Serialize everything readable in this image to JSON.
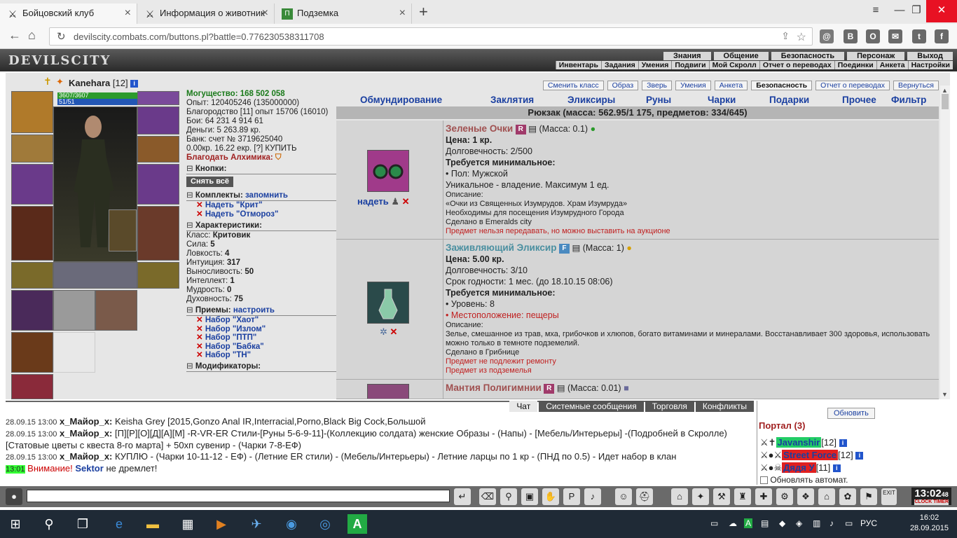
{
  "browser": {
    "tabs": [
      {
        "title": "Бойцовский клуб",
        "icon": "swords-icon"
      },
      {
        "title": "Информация о животник",
        "icon": "swords-icon"
      },
      {
        "title": "Подземка",
        "icon": "dungeon-icon"
      }
    ],
    "url": "devilscity.combats.com/buttons.pl?battle=0.776230538311708"
  },
  "game": {
    "logo": "DEVILSCITY",
    "topnav": [
      "Знания",
      "Общение",
      "Безопасность",
      "Персонаж",
      "Выход"
    ],
    "subnav": [
      "Инвентарь",
      "Задания",
      "Умения",
      "Подвиги",
      "Мой Скролл",
      "Отчет о переводах",
      "Поединки",
      "Анкета",
      "Настройки"
    ]
  },
  "character": {
    "name": "Kanehara",
    "level": "[12]",
    "hp": "3607/3607",
    "mana": "51/51",
    "power_label": "Могущество: 168 502 058",
    "lines": [
      "Опыт: 120405246 (135000000)",
      "Благородство [11] опыт 15706 (16010)",
      "Бои:  64 231  4 914  61",
      "Деньги: 5 263.89 кр.",
      "Банк: счет № 3719625040",
      "0.00кр. 16.22 екр. [?] КУПИТЬ"
    ],
    "alchemist": "Благодать Алхимика:",
    "buttons_section": "Кнопки:",
    "undress_btn": "Снять всё",
    "sets_section": "Комплекты:",
    "sets_remember": "запомнить",
    "sets": [
      "Надеть \"Крит\"",
      "Надеть \"Отмороз\""
    ],
    "char_section": "Характеристики:",
    "attributes": [
      {
        "k": "Класс:",
        "v": "Критовик"
      },
      {
        "k": "Сила:",
        "v": "5"
      },
      {
        "k": "Ловкость:",
        "v": "4"
      },
      {
        "k": "Интуиция:",
        "v": "317"
      },
      {
        "k": "Выносливость:",
        "v": "50"
      },
      {
        "k": "Интеллект:",
        "v": "1"
      },
      {
        "k": "Мудрость:",
        "v": "0"
      },
      {
        "k": "Духовность:",
        "v": "75"
      }
    ],
    "tricks_section": "Приемы:",
    "tricks_config": "настроить",
    "tricks": [
      "Набор \"Хаот\"",
      "Набор \"Излом\"",
      "Набор \"ПТП\"",
      "Набор \"Бабка\"",
      "Набор \"ТН\""
    ],
    "mods_section": "Модификаторы:"
  },
  "panel": {
    "top_buttons": [
      "Сменить класс",
      "Образ",
      "Зверь",
      "Умения",
      "Анкета",
      "Безопасность",
      "Отчет о переводах",
      "Вернуться"
    ],
    "categories": [
      "Обмундирование",
      "Заклятия",
      "Эликсиры",
      "Руны",
      "Чарки",
      "Подарки",
      "Прочее",
      "Фильтр"
    ],
    "bag_title": "Рюкзак (масса: 562.95/1 175, предметов: 334/645)",
    "items": [
      {
        "name": "Зеленые Очки",
        "tag": "R",
        "mass": "(Масса: 0.1)",
        "price": "Цена: 1 кр.",
        "durability": "Долговечность: 2/500",
        "req": "Требуется минимальное:",
        "lines": [
          "• Пол: Мужской",
          "Уникальное - владение. Максимум 1 ед."
        ],
        "desc_label": "Описание:",
        "desc": [
          "«Очки из Священных Изумрудов. Храм Изумруда»",
          "Необходимы для посещения Изумрудного Города",
          "Сделано в Emeralds city"
        ],
        "note": "Предмет нельзя передавать, но можно выставить на аукционе",
        "action": "надеть"
      },
      {
        "name": "Заживляющий Эликсир",
        "tag": "F",
        "mass": "(Масса: 1)",
        "price": "Цена: 5.00 кр.",
        "durability": "Долговечность: 3/10",
        "expiry": "Срок годности: 1 мес. (до 18.10.15 08:06)",
        "req": "Требуется минимальное:",
        "level": "• Уровень: 8",
        "location": "• Местоположение: пещеры",
        "desc_label": "Описание:",
        "desc": "Зелье, смешанное из трав, мха, грибочков и хлюпов, богато витаминами и минералами. Восстанавливает 300 здоровья, использовать можно только в темноте подземелий.",
        "made": "Сделано в Грибнице",
        "note1": "Предмет не подлежит ремонту",
        "note2": "Предмет из подземелья"
      },
      {
        "name": "Мантия Полигимнии",
        "tag": "R",
        "mass": "(Масса: 0.01)"
      }
    ]
  },
  "chat": {
    "tabs": [
      "Чат",
      "Системные сообщения",
      "Торговля",
      "Конфликты"
    ],
    "messages": [
      {
        "time": "28.09.15 13:00",
        "nick": "x_Майор_x:",
        "text": "Keisha Grey [2015,Gonzo Anal IR,Interracial,Porno,Black Big Cock,Большой"
      },
      {
        "time": "28.09.15 13:00",
        "nick": "x_Майор_x:",
        "text": "[П][Р][О][Д][А][М] -R-VR-ER Стили-[Руны 5-6-9-11]-(Коллекцию солдата) женские Образы - (Напы) - [Мебель/Интерьеры] -(Подробней в Скролле)[Статовые цветы с квеста 8-го марта] + 50хп сувенир - (Чарки 7-8-ЕФ)"
      },
      {
        "time": "28.09.15 13:00",
        "nick": "x_Майор_x:",
        "text": "КУПЛЮ - (Чарки 10-11-12 - ЕФ) - (Летние ER стили) - (Мебель/Интерьеры) - Летние ларцы по 1 кр - (ПНД по 0.5) - Идет набор в клан"
      }
    ],
    "system": {
      "time": "13:01",
      "warn": "Внимание!",
      "name": "Sektor",
      "text": "не дремлет!"
    }
  },
  "portal": {
    "refresh": "Обновить",
    "title": "Портал (3)",
    "players": [
      {
        "name": "Javanshir",
        "level": "[12]",
        "bg": "#22cc66"
      },
      {
        "name": "Street Force",
        "level": "[12]",
        "bg": "#e02020"
      },
      {
        "name": "Дядя У",
        "level": "[11]",
        "bg": "#e02020"
      }
    ],
    "auto_refresh": "Обновлять автомат."
  },
  "clock": {
    "time": "13:02",
    "sec": "48",
    "labels": [
      "CLOCK",
      "TIMER"
    ],
    "exit": "EXIT"
  },
  "taskbar": {
    "lang": "РУС",
    "time": "16:02",
    "date": "28.09.2015"
  }
}
